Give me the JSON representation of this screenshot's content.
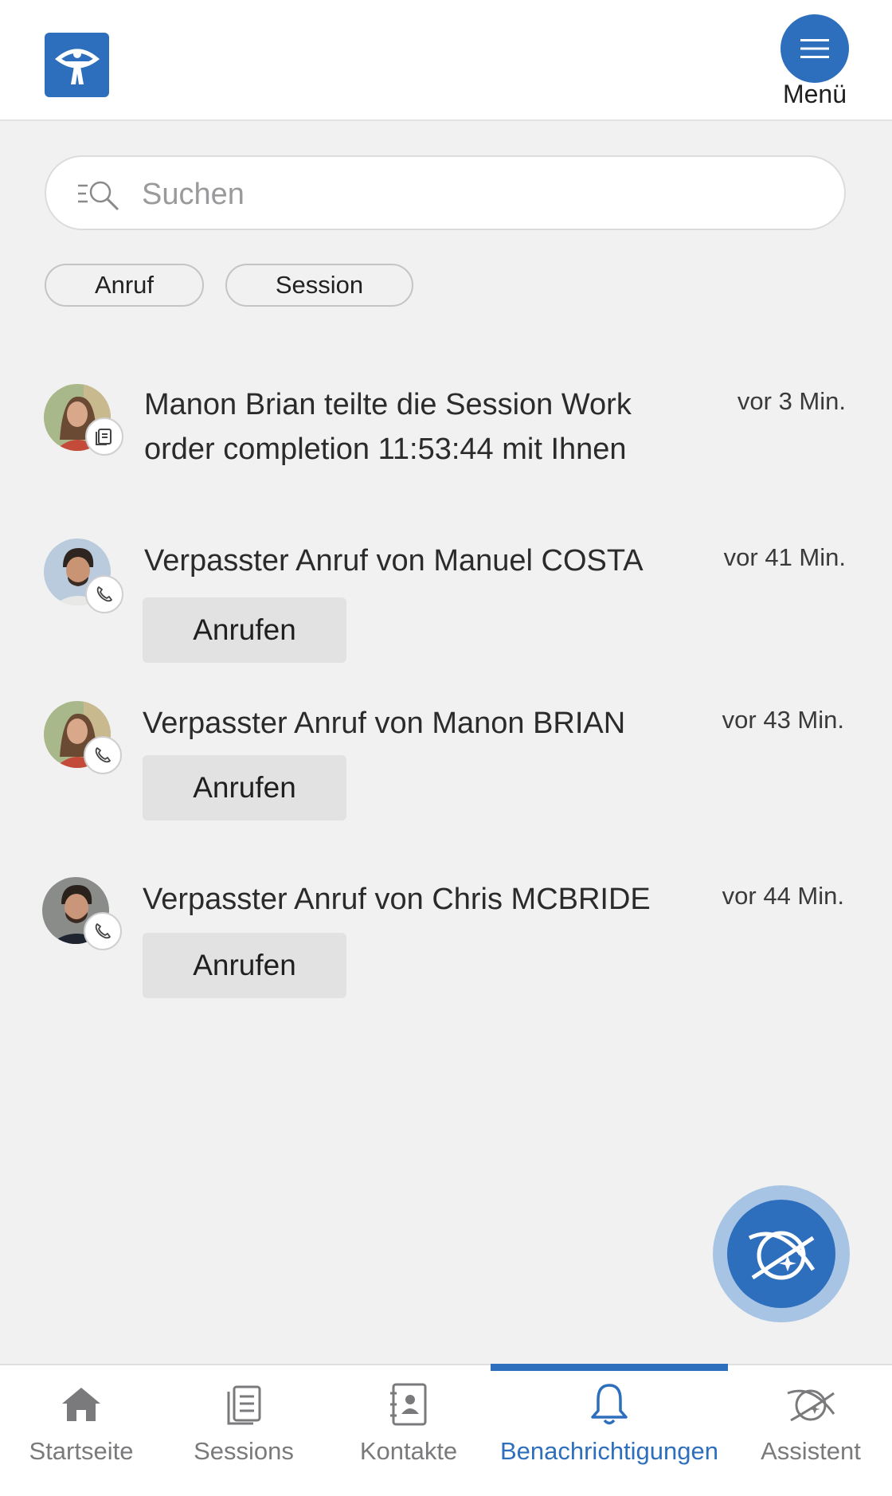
{
  "header": {
    "logo_icon": "accessibility-person-icon",
    "menu_icon": "hamburger-icon",
    "menu_label": "Menü",
    "accent": "#2e6fbd"
  },
  "search": {
    "placeholder": "Suchen",
    "icon": "list-search-icon"
  },
  "filters": [
    {
      "label": "Anruf"
    },
    {
      "label": "Session"
    }
  ],
  "notifications": [
    {
      "text": "Manon Brian teilte die Session Work order completion 11:53:44 mit Ihnen",
      "time": "vor 3 Min.",
      "badge_icon": "document-icon",
      "action": ""
    },
    {
      "text": "Verpasster Anruf von Manuel COSTA",
      "time": "vor 41 Min.",
      "badge_icon": "phone-icon",
      "action": "Anrufen"
    },
    {
      "text": "Verpasster Anruf von Manon BRIAN",
      "time": "vor 43 Min.",
      "badge_icon": "phone-icon",
      "action": "Anrufen"
    },
    {
      "text": "Verpasster Anruf von Chris MCBRIDE",
      "time": "vor 44 Min.",
      "badge_icon": "phone-icon",
      "action": "Anrufen"
    }
  ],
  "fab": {
    "icon": "assistant-planet-icon"
  },
  "bottom_nav": [
    {
      "label": "Startseite",
      "icon": "home-icon",
      "active": false
    },
    {
      "label": "Sessions",
      "icon": "sessions-icon",
      "active": false
    },
    {
      "label": "Kontakte",
      "icon": "contacts-icon",
      "active": false
    },
    {
      "label": "Benachrichtigungen",
      "icon": "bell-icon",
      "active": true
    },
    {
      "label": "Assistent",
      "icon": "assistant-icon",
      "active": false
    }
  ]
}
